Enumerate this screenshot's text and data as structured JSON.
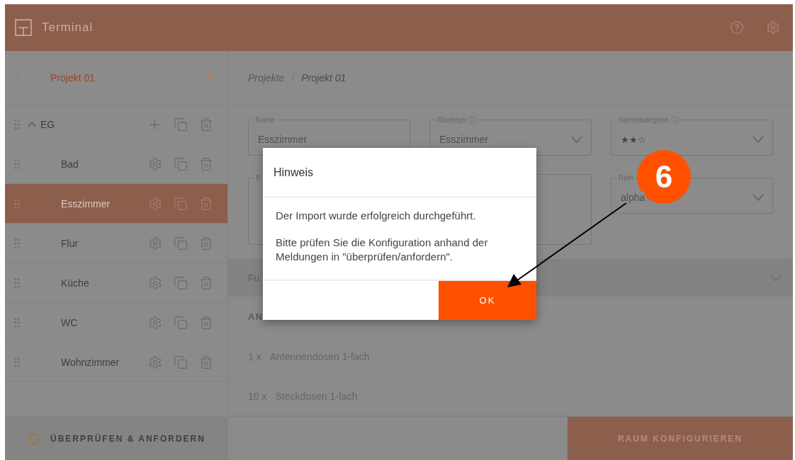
{
  "header": {
    "title": "Terminal"
  },
  "sidebar": {
    "project": "Projekt 01",
    "tree": [
      {
        "label": "EG",
        "expanded": true,
        "children": [
          {
            "label": "Bad",
            "selected": false
          },
          {
            "label": "Esszimmer",
            "selected": true
          },
          {
            "label": "Flur",
            "selected": false
          },
          {
            "label": "Küche",
            "selected": false
          },
          {
            "label": "WC",
            "selected": false
          },
          {
            "label": "Wohnzimmer",
            "selected": false
          }
        ]
      }
    ],
    "footer_button": "ÜBERPRÜFEN & ANFORDERN"
  },
  "breadcrumb": {
    "items": [
      "Projekte",
      "Projekt 01"
    ],
    "separator": "/"
  },
  "form": {
    "fields": [
      {
        "kind": "text",
        "label": "Name",
        "value": "Esszimmer"
      },
      {
        "kind": "select",
        "label": "Raumtyp",
        "info": true,
        "value": "Esszimmer"
      },
      {
        "kind": "stars",
        "label": "Sternekategorie",
        "info": true,
        "stars": 2
      },
      {
        "kind": "textarea",
        "label": "B"
      },
      {
        "kind": "textarea"
      },
      {
        "kind": "select",
        "label": "Reih",
        "value": "alpha"
      }
    ]
  },
  "accordion": {
    "label": "Fu",
    "expanded": false
  },
  "section": {
    "title": "AN",
    "items": [
      {
        "qty": "1 x",
        "name": "Antennendosen 1-fach"
      },
      {
        "qty": "10 x",
        "name": "Steckdosen 1-fach"
      }
    ]
  },
  "footer_button": "RAUM KONFIGURIEREN",
  "dialog": {
    "title": "Hinweis",
    "paragraphs": [
      "Der Import wurde erfolgreich durchgeführt.",
      "Bitte prüfen Sie die Konfiguration anhand der Meldungen in \"überprüfen/anfordern\"."
    ],
    "button": "OK"
  },
  "callout": {
    "number": "6"
  }
}
